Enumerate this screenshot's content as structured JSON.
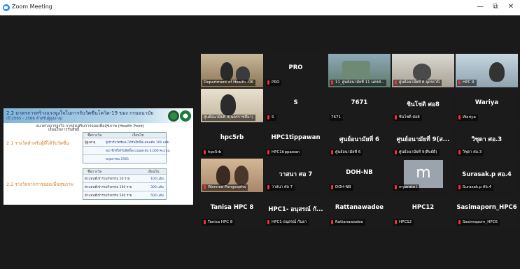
{
  "window": {
    "title": "Zoom Meeting",
    "minimize": "—",
    "restore": "⧉",
    "close": "✕"
  },
  "share": {
    "title": "2.2 มาตรการสร้างแรงจูงใจในการรับวัคซีนโควิด-19 ของ กรมอนามัย",
    "subtitle": "(ปี 2565 - 2566 สำหรับผู้สูงอายุ)",
    "heading": "แนวทางการจูงใจ การส่งเสริมการออมเพื่อสุขภาพ (Health Point)",
    "subheading": "เงื่อนไขการรับสิทธิ์",
    "group1": "2.1 รางวัลสำหรับผู้ที่ได้รับวัคซีน",
    "group2": "2.2 รางวัลจากการออมเพื่อสุขภาพ",
    "table1": {
      "col1": "ชื่อรางวัล",
      "col2": "เงื่อนไข",
      "rows": [
        {
          "label": "ผู้สูงอายุ",
          "text": "ผู้เข้ารับวัคซีนจะได้รับสิทธิ์สะสมแต้ม 100 แต้ม"
        },
        {
          "label": "",
          "text": "สมาชิกที่ได้รับสิทธิ์คะแนนสะสม 4,000 คะแนน"
        },
        {
          "label": "",
          "text": "พฤษภาคม 2565"
        }
      ]
    },
    "table2": {
      "col1": "ชื่อรางวัล",
      "col2": "เงื่อนไข",
      "rows": [
        {
          "text": "ตัวแทนที่เข้าร่วมกิจกรรม 50 ราย",
          "value": "100 แต้ม"
        },
        {
          "text": "ตัวแทนที่เข้าร่วมกิจกรรม 100 ราย",
          "value": "300 แต้ม"
        },
        {
          "text": "ตัวแทนที่เข้าร่วมกิจกรรม 500 ราย",
          "value": "500 แต้ม"
        }
      ]
    }
  },
  "participants": [
    {
      "id": "p1",
      "title": "",
      "label": "Department of Health -06"
    },
    {
      "id": "p2",
      "title": "PRO",
      "label": "PRO"
    },
    {
      "id": "p3",
      "title": "",
      "label": "11_ศูนย์อนามัยที่ 11 นครศ..."
    },
    {
      "id": "p4",
      "title": "",
      "label": "ศูนย์อนามัยที่ 8 อุดรธานี"
    },
    {
      "id": "p5",
      "title": "",
      "label": "HPC 9"
    },
    {
      "id": "p6",
      "title": "",
      "label": "ศูนย์อนามัยที่ 9(นครราชสีมา)"
    },
    {
      "id": "p7",
      "title": "S",
      "label": "S"
    },
    {
      "id": "p8",
      "title": "7671",
      "label": "7671"
    },
    {
      "id": "p9",
      "title": "ชินโชติ ศอ8",
      "label": "ชินโชติ ศอ8"
    },
    {
      "id": "p10",
      "title": "Wariya",
      "label": "Wariya"
    },
    {
      "id": "p11",
      "title": "hpc5rb",
      "label": "hpc5rb"
    },
    {
      "id": "p12",
      "title": "HPC1tippawan",
      "label": "HPC1tippawan"
    },
    {
      "id": "p13",
      "title": "ศูนย์อนามัยที่ 6",
      "label": "ศูนย์อนามัยที่ 6"
    },
    {
      "id": "p14",
      "title": "ศูนย์อนามัยที่ 9(ส...",
      "label": "ศูนย์อนามัยที่ 9(ศิษย์ดี)"
    },
    {
      "id": "p15",
      "title": "วิชุดา ศอ.3",
      "label": "วิชุดา ศอ.3"
    },
    {
      "id": "p16",
      "title": "",
      "label": "Wannee-Pongsopha"
    },
    {
      "id": "p17",
      "title": "วาสนา ศอ 7",
      "label": "วาสนา ศอ 7"
    },
    {
      "id": "p18",
      "title": "DOH-NB",
      "label": "DOH-NB"
    },
    {
      "id": "p19",
      "title": "m",
      "label": "myarate i"
    },
    {
      "id": "p20",
      "title": "Surasak.p ศอ.4",
      "label": "Surasak.p ศอ.4"
    },
    {
      "id": "p21",
      "title": "Tanisa HPC 8",
      "label": "Tanisa HPC 8"
    },
    {
      "id": "p22",
      "title": "HPC1- อนุสรณ์ กั...",
      "label": "HPC1-อนุสรณ์ กันยา"
    },
    {
      "id": "p23",
      "title": "Rattanawadee",
      "label": "Rattanawadee"
    },
    {
      "id": "p24",
      "title": "HPC12",
      "label": "HPC12"
    },
    {
      "id": "p25",
      "title": "Sasimaporn_HPC6",
      "label": "Sasimaporn_HPC6"
    }
  ],
  "colors": {
    "mic_muted": "#e33333",
    "background": "#1a1a1a",
    "accent": "#2d8cff"
  },
  "icons": {
    "app": "zoom-logo-icon",
    "mic": "mic-muted-icon"
  }
}
